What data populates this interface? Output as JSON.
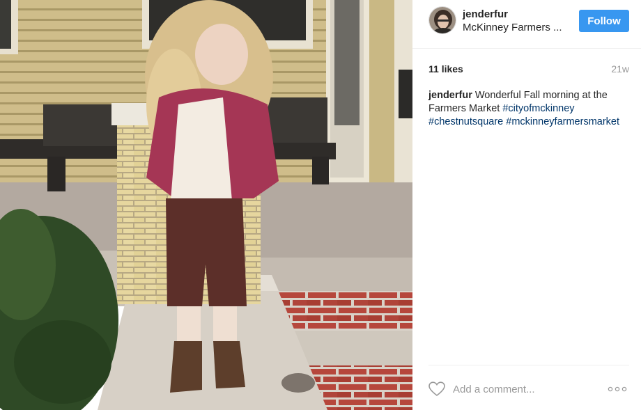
{
  "post": {
    "username": "jenderfur",
    "location": "McKinney Farmers ...",
    "follow_label": "Follow",
    "likes": "11 likes",
    "age": "21w",
    "caption": {
      "username": "jenderfur",
      "text": "Wonderful Fall morning at the Farmers Market",
      "hashtags": [
        "#cityofmckinney",
        "#chestnutsquare",
        "#mckinneyfarmersmarket"
      ]
    },
    "comment_placeholder": "Add a comment..."
  },
  "icons": {
    "like": "heart-outline-icon",
    "more": "more-options-icon"
  },
  "colors": {
    "follow_button": "#3897f0",
    "hashtag": "#003569",
    "muted_text": "#999999",
    "divider": "#efefef"
  }
}
